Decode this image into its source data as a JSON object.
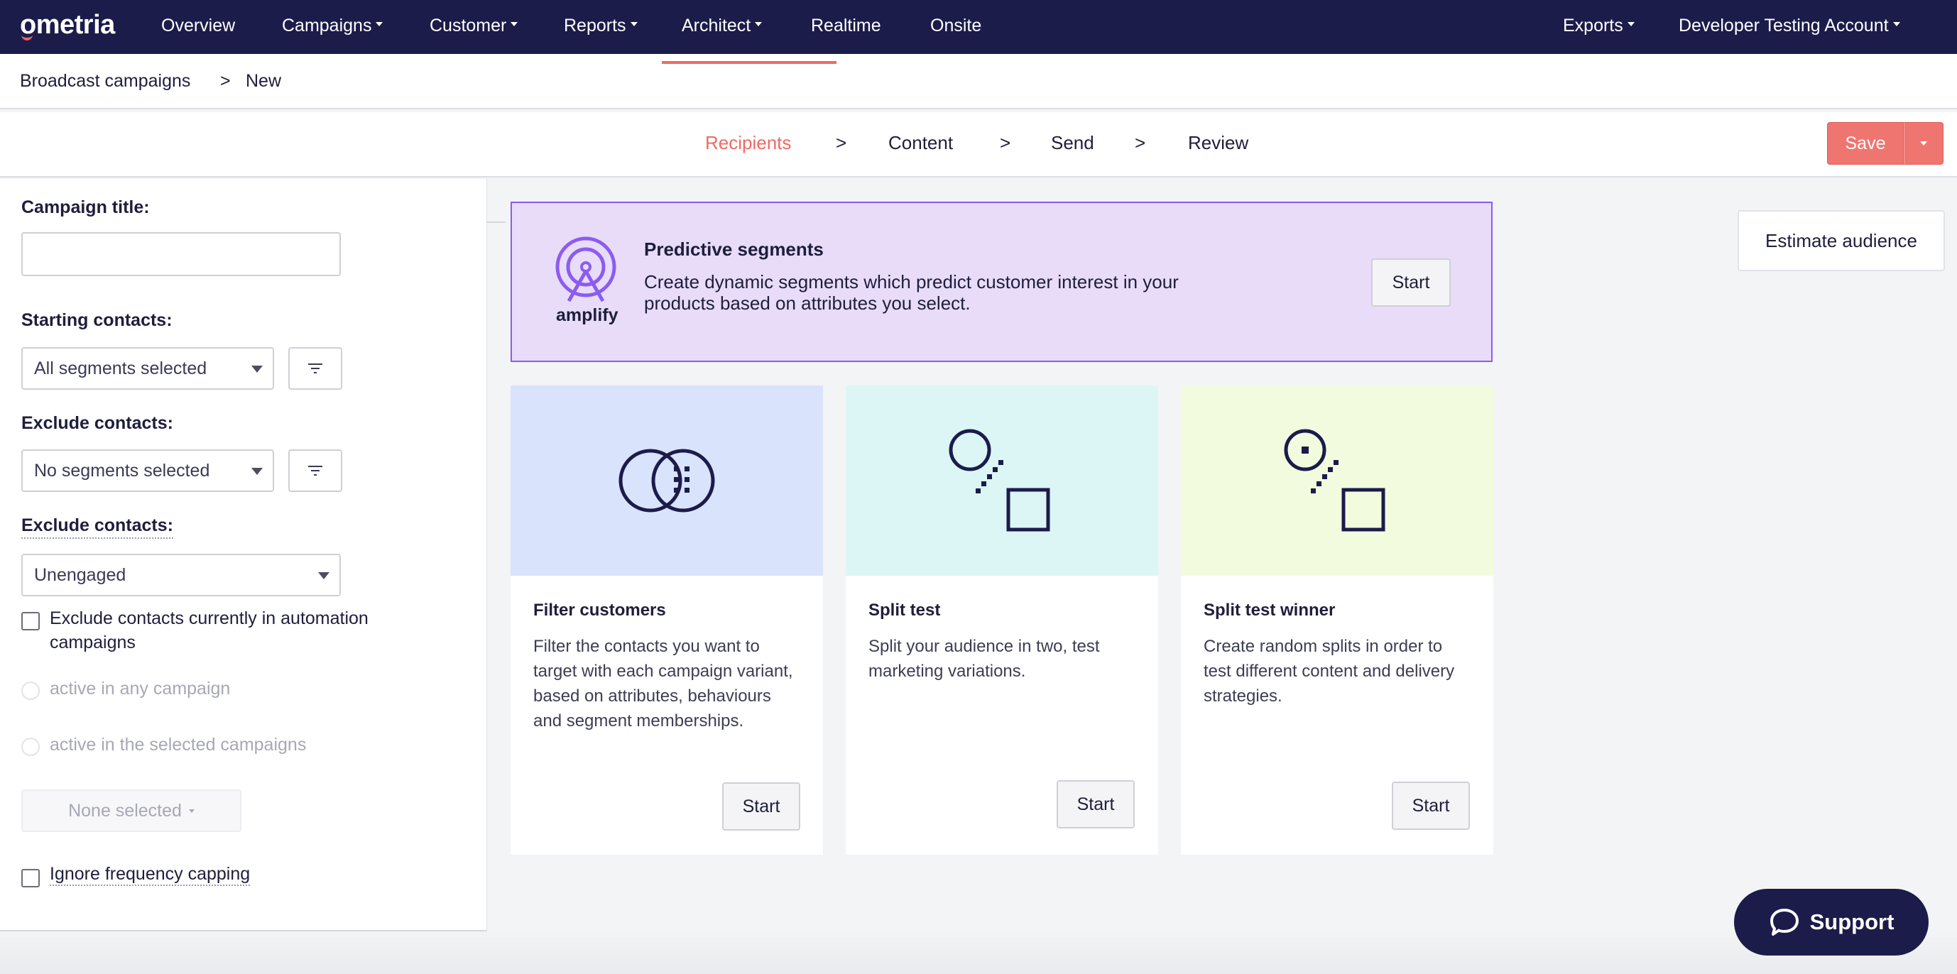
{
  "nav": {
    "logo": "ometria",
    "items": [
      {
        "label": "Overview",
        "dropdown": false
      },
      {
        "label": "Campaigns",
        "dropdown": true
      },
      {
        "label": "Customer",
        "dropdown": true
      },
      {
        "label": "Reports",
        "dropdown": true
      },
      {
        "label": "Architect",
        "dropdown": true
      },
      {
        "label": "Realtime",
        "dropdown": false
      },
      {
        "label": "Onsite",
        "dropdown": false
      }
    ],
    "exports": "Exports",
    "account": "Developer Testing Account"
  },
  "breadcrumb": {
    "parent": "Broadcast campaigns",
    "separator": ">",
    "current": "New"
  },
  "steps": {
    "items": [
      "Recipients",
      "Content",
      "Send",
      "Review"
    ],
    "separator": ">",
    "active": "Recipients"
  },
  "toolbar": {
    "save_label": "Save"
  },
  "form": {
    "campaign_title_label": "Campaign title:",
    "campaign_title_value": "",
    "starting_contacts_label": "Starting contacts:",
    "starting_contacts_value": "All segments selected",
    "exclude_contacts_label": "Exclude contacts:",
    "exclude_segments_value": "No segments selected",
    "exclude_engagement_label": "Exclude contacts:",
    "exclude_engagement_value": "Unengaged",
    "exclude_automation_label": "Exclude contacts currently in automation campaigns",
    "radio_any": "active in any campaign",
    "radio_selected": "active in the selected campaigns",
    "none_selected": "None selected",
    "ignore_capping_label": "Ignore frequency capping"
  },
  "predictive": {
    "brand": "amplify",
    "title": "Predictive segments",
    "description": "Create dynamic segments which predict customer interest in your products based on attributes you select.",
    "button": "Start"
  },
  "cards": [
    {
      "title": "Filter customers",
      "description": "Filter the contacts you want to target with each campaign variant, based on attributes, behaviours and segment memberships.",
      "button": "Start",
      "color": "#d9e3fb"
    },
    {
      "title": "Split test",
      "description": "Split your audience in two, test marketing variations.",
      "button": "Start",
      "color": "#dcf6f6"
    },
    {
      "title": "Split test winner",
      "description": "Create random splits in order to test different content and delivery strategies.",
      "button": "Start",
      "color": "#f3fbde"
    }
  ],
  "estimate_label": "Estimate audience",
  "support_label": "Support",
  "colors": {
    "nav_bg": "#1b1c4a",
    "accent": "#ef6a62",
    "predictive_bg": "#e8dcf9",
    "predictive_border": "#8b5cf0"
  }
}
